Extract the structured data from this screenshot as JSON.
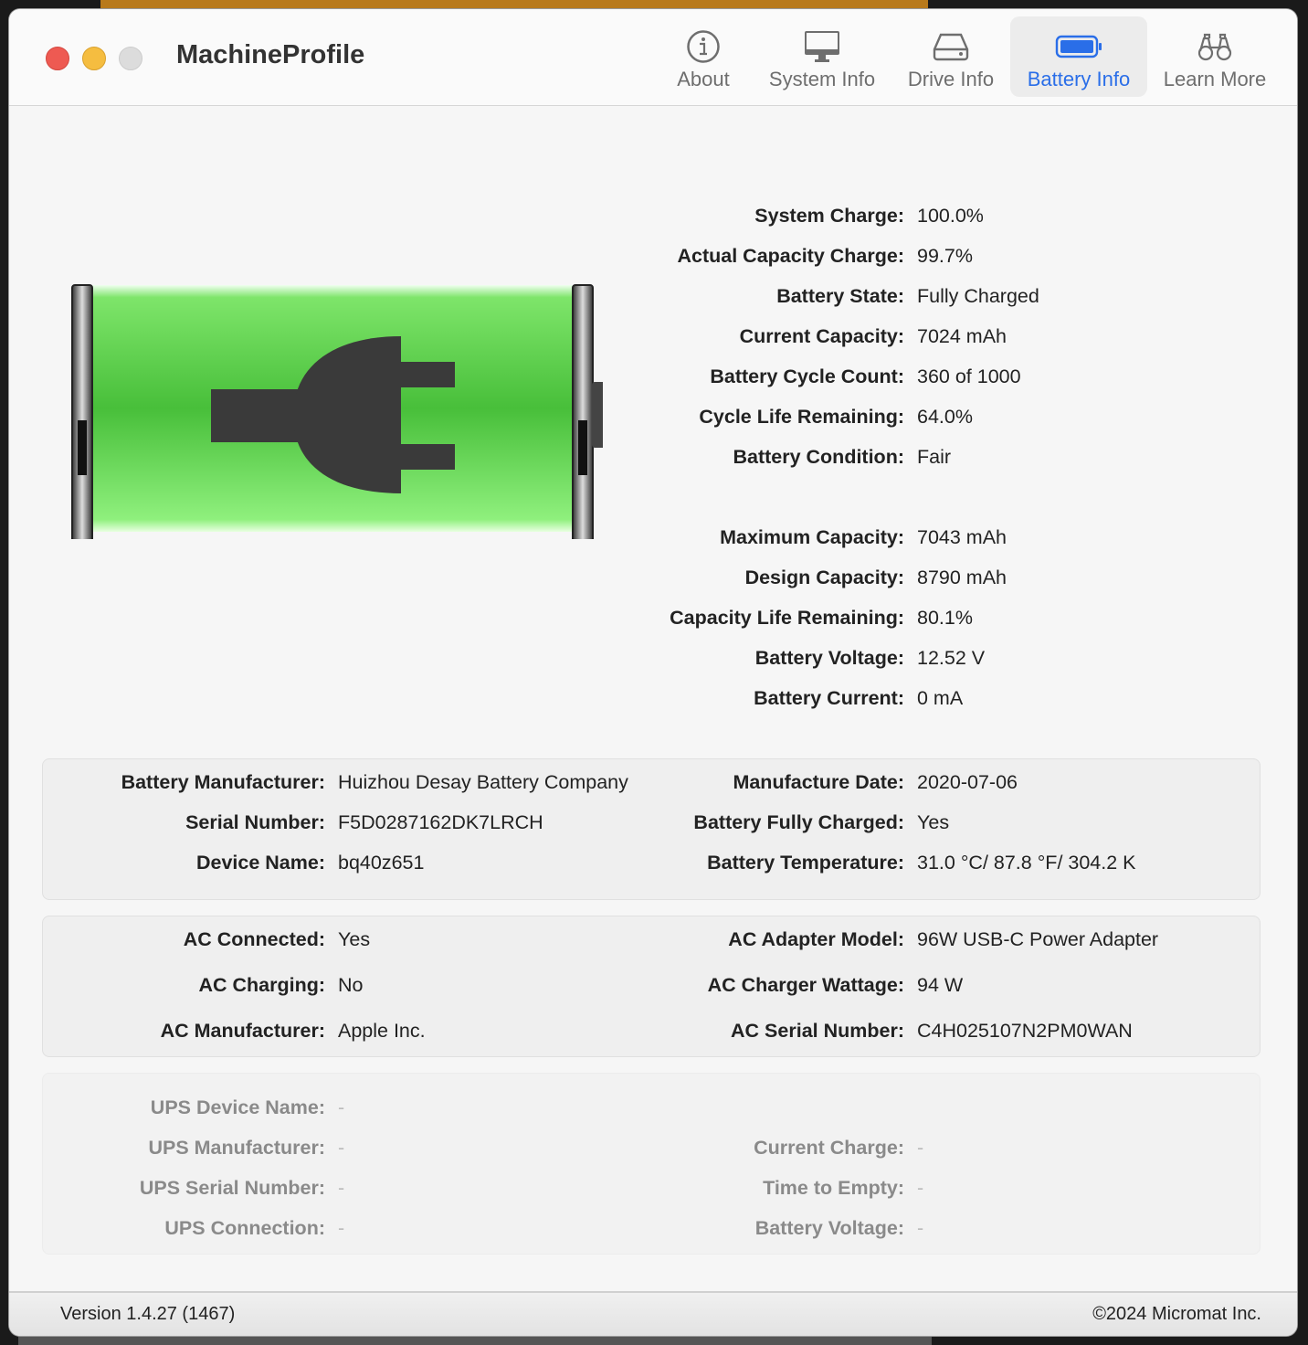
{
  "window": {
    "title": "MachineProfile"
  },
  "toolbar": [
    {
      "label": "About",
      "icon": "info-icon"
    },
    {
      "label": "System Info",
      "icon": "monitor-icon"
    },
    {
      "label": "Drive Info",
      "icon": "drive-icon"
    },
    {
      "label": "Battery Info",
      "icon": "battery-icon",
      "selected": true
    },
    {
      "label": "Learn More",
      "icon": "binoculars-icon"
    }
  ],
  "battery_graphic": {
    "charge_percent": 100,
    "icon": "plug-icon",
    "fill_color": "#5fd94a"
  },
  "summary": [
    {
      "label": "System Charge:",
      "value": "100.0%"
    },
    {
      "label": "Actual Capacity Charge:",
      "value": "99.7%"
    },
    {
      "label": "Battery State:",
      "value": "Fully Charged"
    },
    {
      "label": "Current Capacity:",
      "value": "7024 mAh"
    },
    {
      "label": "Battery Cycle Count:",
      "value": "360 of 1000"
    },
    {
      "label": "Cycle Life Remaining:",
      "value": "64.0%"
    },
    {
      "label": "Battery Condition:",
      "value": "Fair"
    },
    {
      "label": "Maximum Capacity:",
      "value": "7043 mAh"
    },
    {
      "label": "Design Capacity:",
      "value": "8790 mAh"
    },
    {
      "label": "Capacity Life Remaining:",
      "value": "80.1%"
    },
    {
      "label": "Battery Voltage:",
      "value": "12.52 V"
    },
    {
      "label": "Battery Current:",
      "value": "0 mA"
    }
  ],
  "battery_box": {
    "left": [
      {
        "label": "Battery Manufacturer:",
        "value": "Huizhou Desay Battery Company"
      },
      {
        "label": "Serial Number:",
        "value": "F5D0287162DK7LRCH"
      },
      {
        "label": "Device Name:",
        "value": "bq40z651"
      }
    ],
    "right": [
      {
        "label": "Manufacture Date:",
        "value": "2020-07-06"
      },
      {
        "label": "Battery Fully Charged:",
        "value": "Yes"
      },
      {
        "label": "Battery Temperature:",
        "value": "31.0 °C/ 87.8 °F/ 304.2 K"
      }
    ]
  },
  "ac_box": {
    "left": [
      {
        "label": "AC Connected:",
        "value": "Yes"
      },
      {
        "label": "AC Charging:",
        "value": "No"
      },
      {
        "label": "AC Manufacturer:",
        "value": "Apple Inc."
      }
    ],
    "right": [
      {
        "label": "AC Adapter Model:",
        "value": "96W USB-C Power Adapter"
      },
      {
        "label": "AC Charger Wattage:",
        "value": "94 W"
      },
      {
        "label": "AC Serial Number:",
        "value": "C4H025107N2PM0WAN"
      }
    ]
  },
  "ups_box": {
    "left": [
      {
        "label": "UPS Device Name:",
        "value": "-"
      },
      {
        "label": "UPS Manufacturer:",
        "value": "-"
      },
      {
        "label": "UPS Serial Number:",
        "value": "-"
      },
      {
        "label": "UPS Connection:",
        "value": "-"
      }
    ],
    "right": [
      {
        "label": "Current Charge:",
        "value": "-"
      },
      {
        "label": "Time to Empty:",
        "value": "-"
      },
      {
        "label": "Battery Voltage:",
        "value": "-"
      }
    ]
  },
  "footer": {
    "version": "Version 1.4.27 (1467)",
    "copyright": "©2024 Micromat Inc."
  }
}
